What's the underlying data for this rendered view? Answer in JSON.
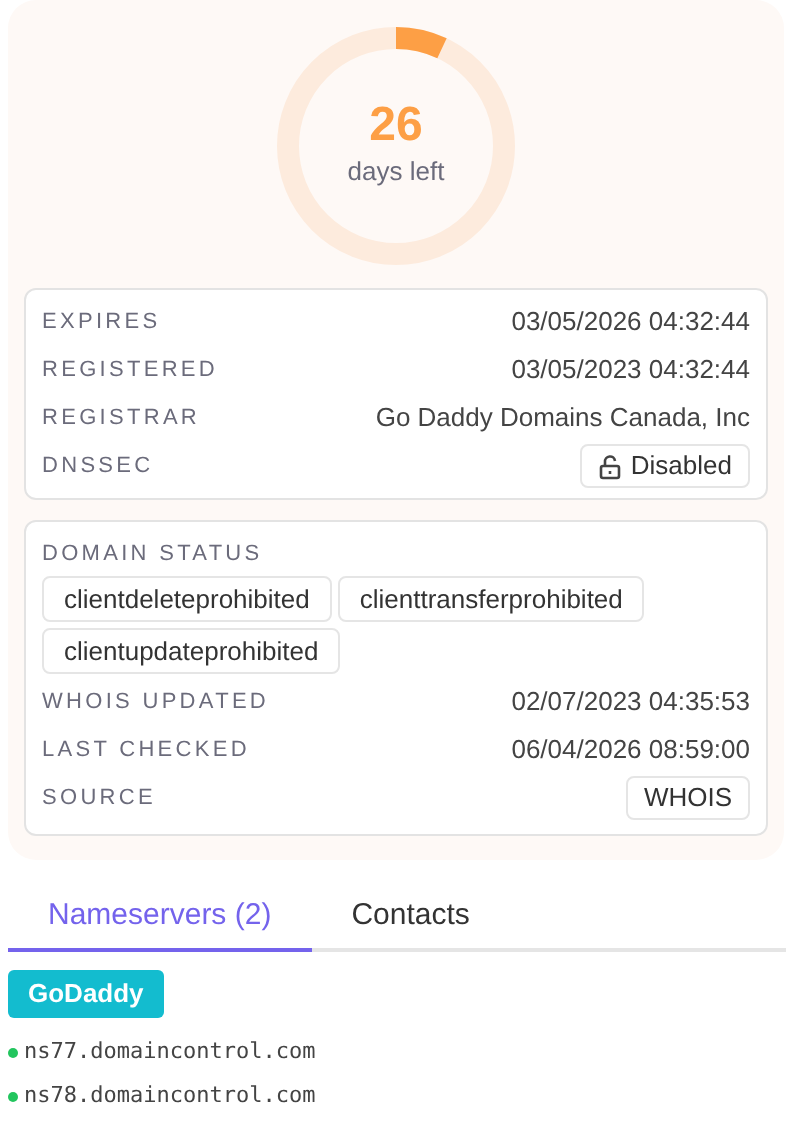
{
  "expiry": {
    "days": "26",
    "label": "days left",
    "level": 0.07
  },
  "dates": [
    {
      "label": "EXPIRES",
      "value": "03/05/2026 04:32:44",
      "kind": "text"
    },
    {
      "label": "REGISTERED",
      "value": "03/05/2023 04:32:44",
      "kind": "text"
    },
    {
      "label": "REGISTRAR",
      "value": "Go Daddy Domains Canada, Inc",
      "kind": "text"
    },
    {
      "label": "DNSSEC",
      "value": "Disabled",
      "kind": "lock"
    }
  ],
  "status": {
    "label": "DOMAIN STATUS",
    "tags": [
      "clientdeleteprohibited",
      "clienttransferprohibited",
      "clientupdateprohibited"
    ]
  },
  "details": [
    {
      "label": "WHOIS UPDATED",
      "value": "02/07/2023 04:35:53",
      "kind": "text"
    },
    {
      "label": "LAST CHECKED",
      "value": "06/04/2026 08:59:00",
      "kind": "text"
    },
    {
      "label": "SOURCE",
      "value": "WHOIS",
      "kind": "tag"
    }
  ],
  "tabs": [
    {
      "label": "Nameservers (2)",
      "selected": true
    },
    {
      "label": "Contacts",
      "selected": false
    }
  ],
  "provider": "GoDaddy",
  "nameservers": [
    "ns77.domaincontrol.com",
    "ns78.domaincontrol.com"
  ]
}
